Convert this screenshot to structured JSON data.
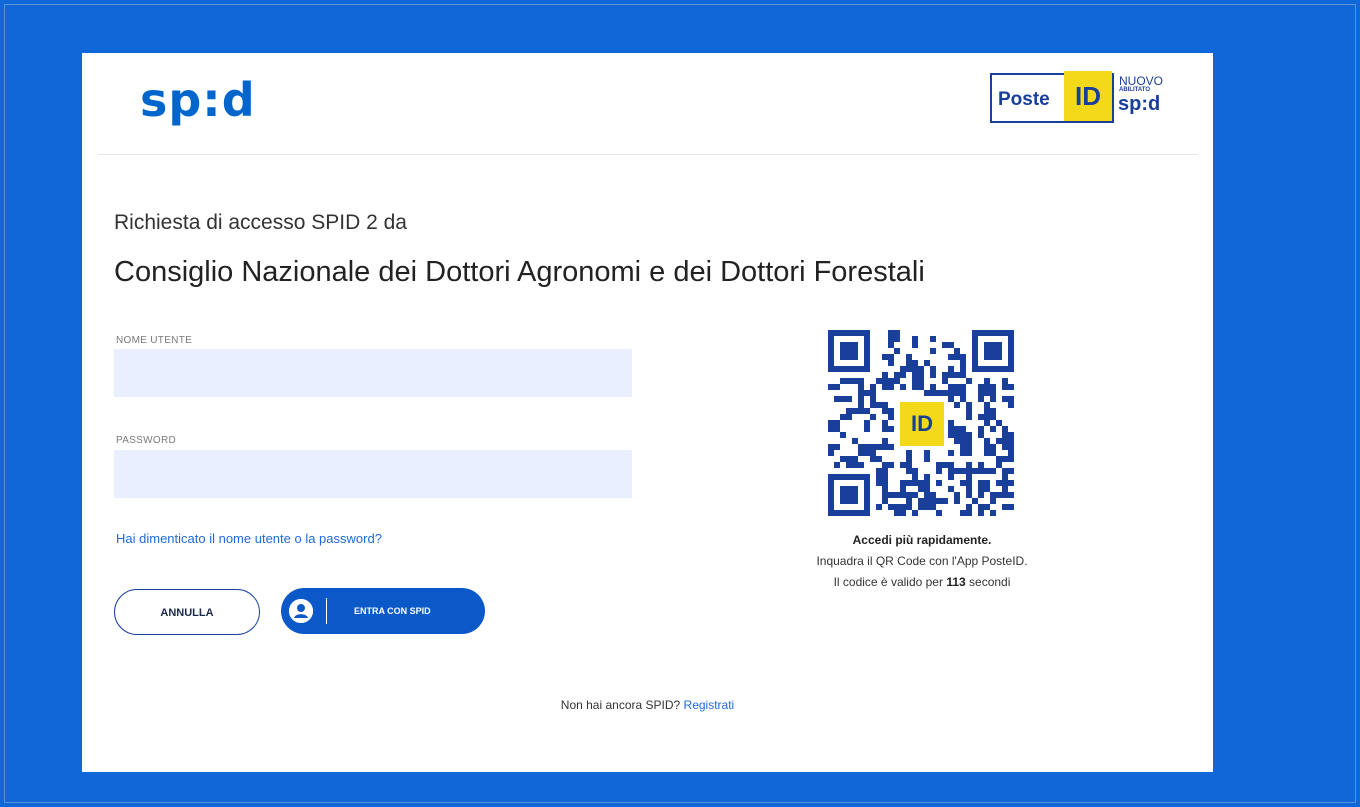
{
  "header": {
    "spid_logo": "sp:d",
    "poste_word": "Poste",
    "poste_id": "ID",
    "badge_nuovo": "NUOVO",
    "badge_abilitato": "ABILITATO",
    "badge_spid": "sp:d"
  },
  "request": {
    "label": "Richiesta di accesso SPID 2 da",
    "organization": "Consiglio Nazionale dei Dottori Agronomi e dei Dottori Forestali"
  },
  "form": {
    "username_label": "NOME UTENTE",
    "username_value": "",
    "password_label": "PASSWORD",
    "password_value": "",
    "forgot_link": "Hai dimenticato il nome utente o la password?",
    "cancel_button": "ANNULLA",
    "submit_button": "ENTRA CON SPID"
  },
  "qr": {
    "center_badge": "ID",
    "title": "Accedi più rapidamente.",
    "instruction": "Inquadra il QR Code con l'App PosteID.",
    "validity_prefix": "Il codice è valido per",
    "validity_seconds": "113",
    "validity_suffix": "secondi"
  },
  "footer": {
    "question": "Non hai ancora SPID?",
    "register_link": "Registrati"
  },
  "colors": {
    "background": "#0f67d8",
    "brand_blue": "#0066cc",
    "poste_yellow": "#f4d91b",
    "button_blue": "#0b59c8",
    "field_bg": "#e9efff"
  },
  "icons": [
    "user-circle-icon",
    "qr-code-icon"
  ]
}
